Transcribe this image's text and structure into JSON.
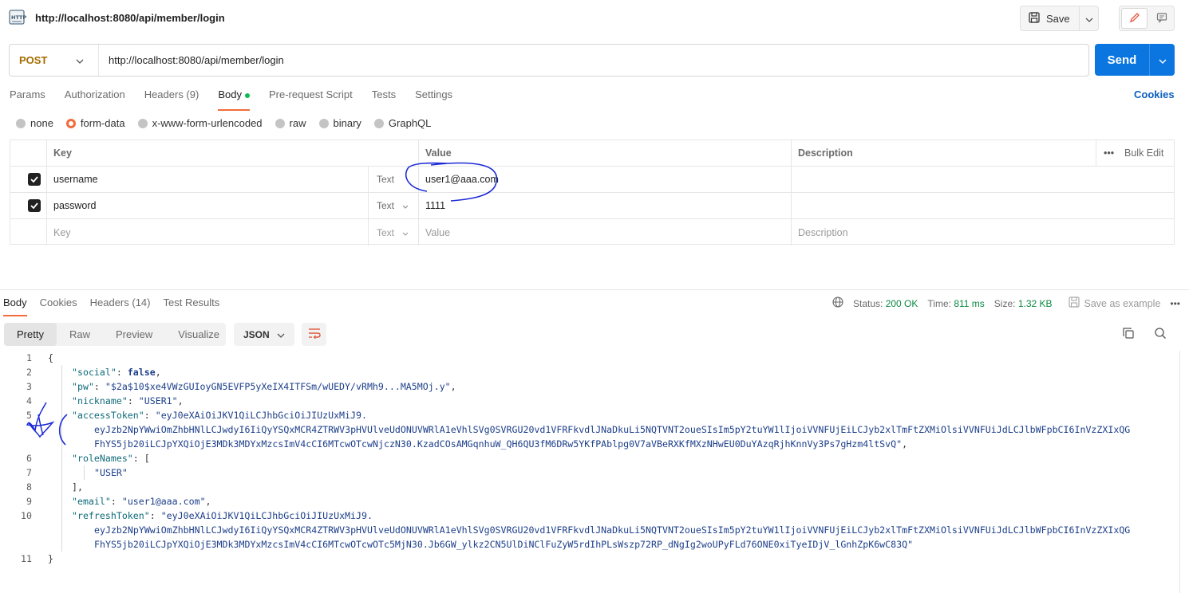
{
  "header": {
    "title": "http://localhost:8080/api/member/login",
    "save_label": "Save"
  },
  "request": {
    "method": "POST",
    "url": "http://localhost:8080/api/member/login",
    "send_label": "Send",
    "tabs": [
      "Params",
      "Authorization",
      "Headers (9)",
      "Body",
      "Pre-request Script",
      "Tests",
      "Settings"
    ],
    "cookies_label": "Cookies",
    "body_types": [
      "none",
      "form-data",
      "x-www-form-urlencoded",
      "raw",
      "binary",
      "GraphQL"
    ],
    "table": {
      "col_key": "Key",
      "col_value": "Value",
      "col_description": "Description",
      "bulk_edit": "Bulk Edit",
      "rows": [
        {
          "key": "username",
          "type": "Text",
          "value": "user1@aaa.com"
        },
        {
          "key": "password",
          "type": "Text",
          "value": "1111"
        }
      ],
      "placeholder": {
        "key": "Key",
        "type": "Text",
        "value": "Value",
        "description": "Description"
      }
    }
  },
  "response": {
    "tabs": [
      "Body",
      "Cookies",
      "Headers (14)",
      "Test Results"
    ],
    "status_label": "Status:",
    "status_value": "200 OK",
    "time_label": "Time:",
    "time_value": "811 ms",
    "size_label": "Size:",
    "size_value": "1.32 KB",
    "save_example": "Save as example",
    "views": [
      "Pretty",
      "Raw",
      "Preview",
      "Visualize"
    ],
    "format": "JSON",
    "code": {
      "l1": "{",
      "social_key": "\"social\"",
      "social_val": "false",
      "pw_key": "\"pw\"",
      "pw_val": "\"$2a$10$xe4VWzGUIoyGN5EVFP5yXeIX4ITFSm/wUEDY/vRMh9...MA5MOj.y\"",
      "nickname_key": "\"nickname\"",
      "nickname_val": "\"USER1\"",
      "access_key": "\"accessToken\"",
      "access_val_1": "\"eyJ0eXAiOiJKV1QiLCJhbGciOiJIUzUxMiJ9.",
      "access_val_2": "eyJzb2NpYWwiOmZhbHNlLCJwdyI6IiQyYSQxMCR4ZTRWV3pHVUlveUdONUVWRlA1eVhlSVg0SVRGU20vd1VFRFkvdlJNaDkuLi5NQTVNT2oueSIsIm5pY2tuYW1lIjoiVVNFUjEiLCJyb2xlTmFtZXMiOlsiVVNFUiJdLCJlbWFpbCI6InVzZXIxQG",
      "access_val_3": "FhYS5jb20iLCJpYXQiOjE3MDk3MDYxMzcsImV4cCI6MTcwOTcwNjczN30.KzadCOsAMGqnhuW_QH6QU3fM6DRw5YKfPAblpg0V7aVBeRXKfMXzNHwEU0DuYAzqRjhKnnVy3Ps7gHzm4ltSvQ\"",
      "roles_key": "\"roleNames\"",
      "roles_open": "[",
      "roles_item": "\"USER\"",
      "roles_close": "],",
      "email_key": "\"email\"",
      "email_val": "\"user1@aaa.com\"",
      "refresh_key": "\"refreshToken\"",
      "refresh_val_1": "\"eyJ0eXAiOiJKV1QiLCJhbGciOiJIUzUxMiJ9.",
      "refresh_val_2": "eyJzb2NpYWwiOmZhbHNlLCJwdyI6IiQyYSQxMCR4ZTRWV3pHVUlveUdONUVWRlA1eVhlSVg0SVRGU20vd1VFRFkvdlJNaDkuLi5NQTVNT2oueSIsIm5pY2tuYW1lIjoiVVNFUjEiLCJyb2xlTmFtZXMiOlsiVVNFUiJdLCJlbWFpbCI6InVzZXIxQG",
      "refresh_val_3": "FhYS5jb20iLCJpYXQiOjE3MDk3MDYxMzcsImV4cCI6MTcwOTcwOTc5MjN30.Jb6GW_ylkz2CN5UlDiNClFuZyW5rdIhPLsWszp72RP_dNgIg2woUPyFLd76ONE0xiTyeIDjV_lGnhZpK6wC83Q\"",
      "close": "}"
    },
    "line_numbers": [
      "1",
      "2",
      "3",
      "4",
      "5",
      "",
      "",
      "6",
      "7",
      "8",
      "9",
      "10",
      "",
      "",
      "11"
    ]
  },
  "colors": {
    "accent": "#f26b3a",
    "send": "#0b76e0",
    "method": "#a46c00",
    "status_ok": "#0b8a41",
    "annotation_ink": "#1d2bd6"
  }
}
